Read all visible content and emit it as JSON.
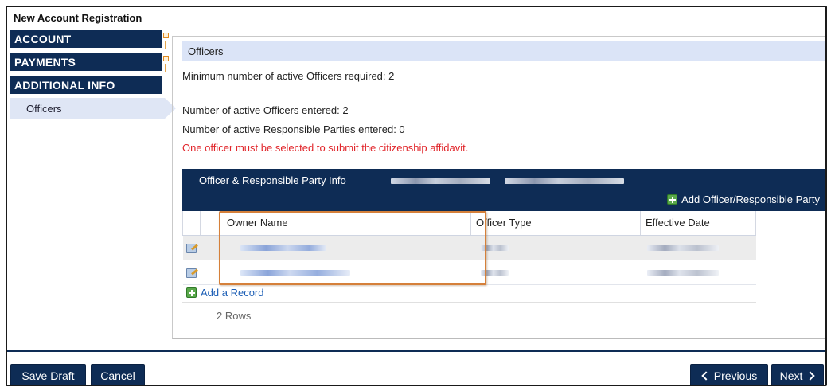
{
  "window": {
    "title": "New Account Registration"
  },
  "sidebar": {
    "items": [
      {
        "label": "ACCOUNT"
      },
      {
        "label": "PAYMENTS"
      },
      {
        "label": "ADDITIONAL INFO"
      }
    ],
    "sub_item": {
      "label": "Officers"
    }
  },
  "section": {
    "header": "Officers",
    "min_required": "Minimum number of active Officers required: 2",
    "active_officers": "Number of active Officers entered: 2",
    "active_parties": "Number of active Responsible Parties entered: 0",
    "warning": "One officer must be selected to submit the citizenship affidavit."
  },
  "grid": {
    "title": "Officer & Responsible Party Info",
    "add_label": "Add Officer/Responsible Party",
    "columns": [
      "Owner Name",
      "Officer Type",
      "Effective Date"
    ],
    "add_record_label": "Add a Record",
    "rows_count": "2 Rows"
  },
  "footer": {
    "save_draft": "Save Draft",
    "cancel": "Cancel",
    "previous": "Previous",
    "next": "Next"
  },
  "colors": {
    "navy": "#0e2c55",
    "section_header_bg": "#dbe4f7",
    "warning_red": "#e1262b",
    "highlight_orange": "#d5803a",
    "link_blue": "#1d5fb6"
  }
}
